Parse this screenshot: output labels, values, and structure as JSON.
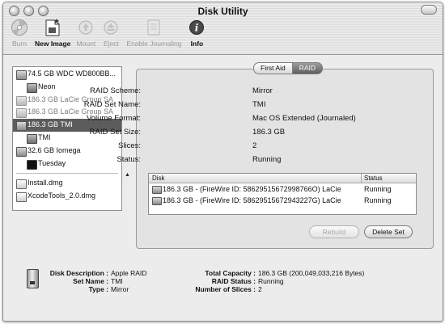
{
  "window": {
    "title": "Disk Utility"
  },
  "toolbar": {
    "items": [
      {
        "label": "Burn",
        "icon": "burn-icon",
        "enabled": false
      },
      {
        "label": "New Image",
        "icon": "new-image-icon",
        "enabled": true
      },
      {
        "label": "Mount",
        "icon": "mount-icon",
        "enabled": false
      },
      {
        "label": "Eject",
        "icon": "eject-icon",
        "enabled": false
      },
      {
        "label": "Enable Journaling",
        "icon": "journaling-icon",
        "enabled": false
      },
      {
        "label": "Info",
        "icon": "info-icon",
        "enabled": true
      }
    ]
  },
  "sidebar": {
    "disks": [
      {
        "label": "74.5 GB WDC WD800BB...",
        "level": 0,
        "icon": "drive-icon"
      },
      {
        "label": "Neon",
        "level": 1,
        "icon": "volume-icon"
      },
      {
        "label": "186.3 GB LaCie Group SA",
        "level": 0,
        "icon": "drive-icon",
        "dim": true
      },
      {
        "label": "186.3 GB LaCie Group SA",
        "level": 0,
        "icon": "drive-icon",
        "dim": true
      },
      {
        "label": "186.3 GB TMI",
        "level": 0,
        "icon": "raid-drive-icon",
        "selected": true
      },
      {
        "label": "TMI",
        "level": 1,
        "icon": "volume-icon"
      },
      {
        "label": "32.6 GB Iomega",
        "level": 0,
        "icon": "drive-icon"
      },
      {
        "label": "Tuesday",
        "level": 1,
        "icon": "volume-icon",
        "black": true
      }
    ],
    "images": [
      {
        "label": "Install.dmg",
        "icon": "disk-image-icon"
      },
      {
        "label": "XcodeTools_2.0.dmg",
        "icon": "disk-image-icon"
      }
    ]
  },
  "tabs": [
    {
      "label": "First Aid",
      "active": false
    },
    {
      "label": "RAID",
      "active": true
    }
  ],
  "raid": {
    "scheme_label": "RAID Scheme:",
    "scheme": "Mirror",
    "set_name_label": "RAID Set Name:",
    "set_name": "TMI",
    "format_label": "Volume Format:",
    "format": "Mac OS Extended (Journaled)",
    "size_label": "RAID Set Size:",
    "size": "186.3 GB",
    "slices_label": "Slices:",
    "slices": "2",
    "status_label": "Status:",
    "status": "Running"
  },
  "disk_table": {
    "columns": [
      "Disk",
      "Status"
    ],
    "rows": [
      {
        "disk": "186.3 GB - (FireWire ID: 58629515672998766O) LaCie",
        "status": "Running"
      },
      {
        "disk": "186.3 GB - (FireWire ID: 58629515672943227G) LaCie",
        "status": "Running"
      }
    ]
  },
  "buttons": {
    "rebuild": "Rebuild",
    "delete_set": "Delete Set"
  },
  "footer": {
    "disk_description_label": "Disk Description :",
    "disk_description": "Apple RAID",
    "set_name_label": "Set Name :",
    "set_name": "TMI",
    "type_label": "Type :",
    "type": "Mirror",
    "total_capacity_label": "Total Capacity :",
    "total_capacity": "186.3 GB (200,049,033,216 Bytes)",
    "raid_status_label": "RAID Status :",
    "raid_status": "Running",
    "num_slices_label": "Number of Slices :",
    "num_slices": "2"
  }
}
